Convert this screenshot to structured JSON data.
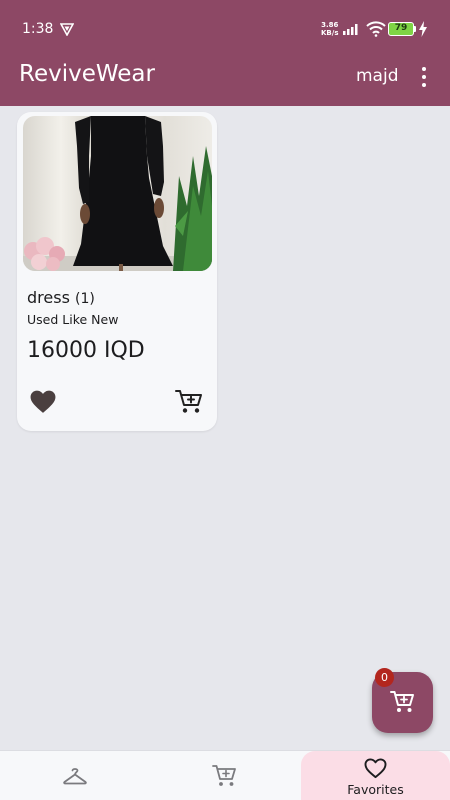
{
  "status_bar": {
    "time": "1:38",
    "net_speed_value": "3.86",
    "net_speed_unit": "KB/s",
    "battery": "79"
  },
  "app_bar": {
    "title": "ReviveWear",
    "user": "majd"
  },
  "products": [
    {
      "name": "dress",
      "count": "(1)",
      "condition": "Used Like New",
      "price": "16000 IQD"
    }
  ],
  "cart_fab": {
    "badge": "0"
  },
  "bottom_nav": {
    "items": [
      {
        "icon": "hanger-icon",
        "label": ""
      },
      {
        "icon": "cart-icon",
        "label": ""
      },
      {
        "icon": "heart-outline-icon",
        "label": "Favorites"
      }
    ],
    "active_index": 2
  },
  "colors": {
    "primary": "#8d4865",
    "background": "#e6e7ec",
    "card": "#f7f8fa",
    "nav_active": "#fbdde6",
    "badge": "#b3261e"
  }
}
